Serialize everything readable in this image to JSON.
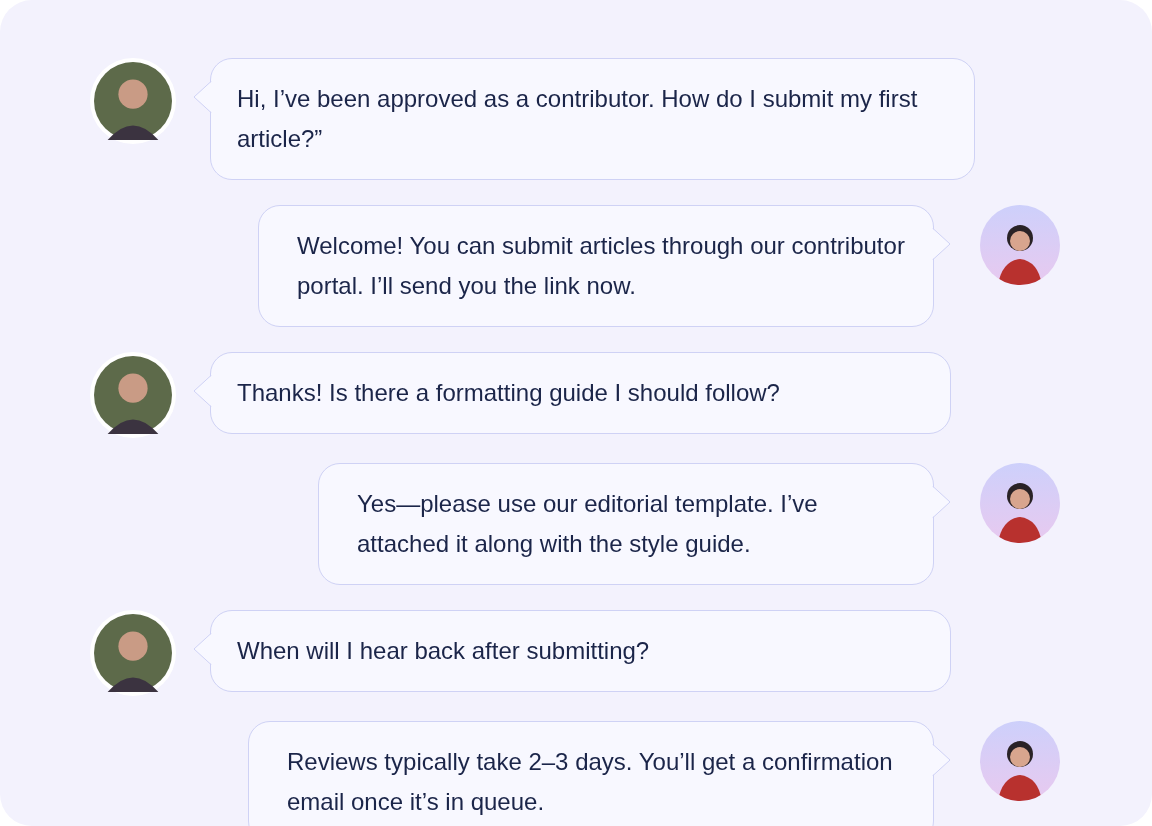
{
  "messages": [
    {
      "kind": "received",
      "text": "Hi, I’ve been approved as a contributor. How do I submit my first article?”"
    },
    {
      "kind": "sent",
      "text": "Welcome! You can submit articles through our contributor portal. I’ll send you the link now."
    },
    {
      "kind": "received",
      "text": "Thanks! Is there a formatting guide I should follow?"
    },
    {
      "kind": "sent",
      "text": "Yes—please use our editorial template. I’ve attached it along with the style guide."
    },
    {
      "kind": "received",
      "text": "When will I hear back after submitting?"
    },
    {
      "kind": "sent",
      "text": "Reviews typically take 2–3 days. You’ll get a confirmation email once it’s in queue."
    }
  ]
}
